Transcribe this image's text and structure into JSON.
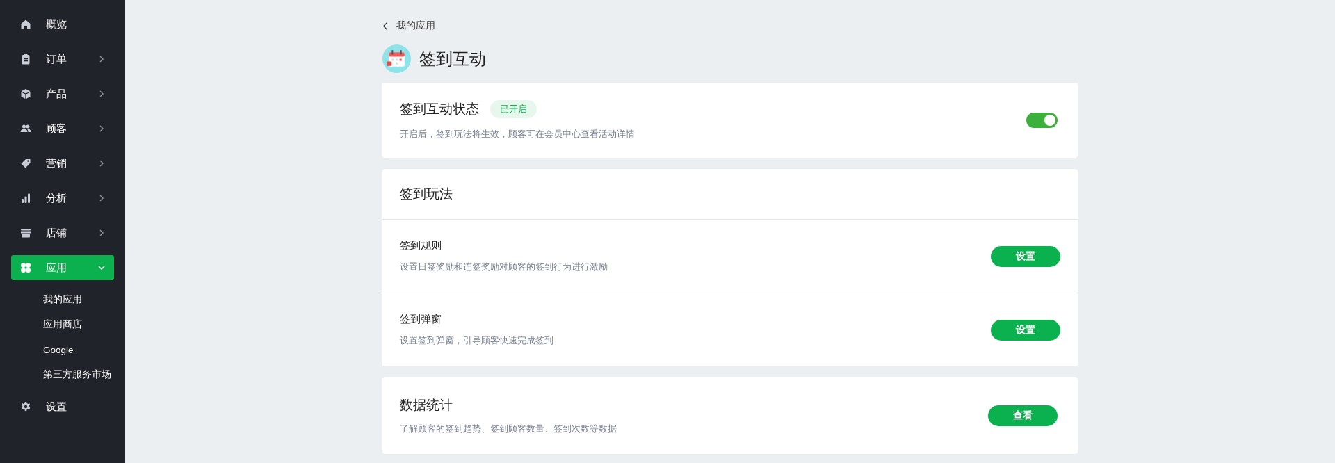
{
  "sidebar": {
    "items": [
      {
        "label": "概览",
        "kind": "link",
        "selected": false
      },
      {
        "label": "订单",
        "kind": "group",
        "expanded": false,
        "selected": false
      },
      {
        "label": "产品",
        "kind": "group",
        "expanded": false,
        "selected": false
      },
      {
        "label": "顾客",
        "kind": "group",
        "expanded": false,
        "selected": false
      },
      {
        "label": "营销",
        "kind": "group",
        "expanded": false,
        "selected": false
      },
      {
        "label": "分析",
        "kind": "group",
        "expanded": false,
        "selected": false
      },
      {
        "label": "店铺",
        "kind": "group",
        "expanded": false,
        "selected": false
      },
      {
        "label": "应用",
        "kind": "group",
        "expanded": true,
        "selected": true,
        "children": [
          {
            "label": "我的应用"
          },
          {
            "label": "应用商店"
          },
          {
            "label": "Google"
          },
          {
            "label": "第三方服务市场"
          }
        ]
      },
      {
        "label": "设置",
        "kind": "link",
        "selected": false
      }
    ]
  },
  "breadcrumb": {
    "back_label": "我的应用"
  },
  "page": {
    "title": "签到互动"
  },
  "status_card": {
    "title": "签到互动状态",
    "badge": "已开启",
    "description": "开启后，签到玩法将生效，顾客可在会员中心查看活动详情",
    "on": true
  },
  "gameplay_card": {
    "title": "签到玩法",
    "rows": [
      {
        "title": "签到规则",
        "description": "设置日签奖励和连签奖励对顾客的签到行为进行激励",
        "button": "设置"
      },
      {
        "title": "签到弹窗",
        "description": "设置签到弹窗，引导顾客快速完成签到",
        "button": "设置"
      }
    ]
  },
  "stats_card": {
    "title": "数据统计",
    "description": "了解顾客的签到趋势、签到顾客数量、签到次数等数据",
    "button": "查看"
  }
}
